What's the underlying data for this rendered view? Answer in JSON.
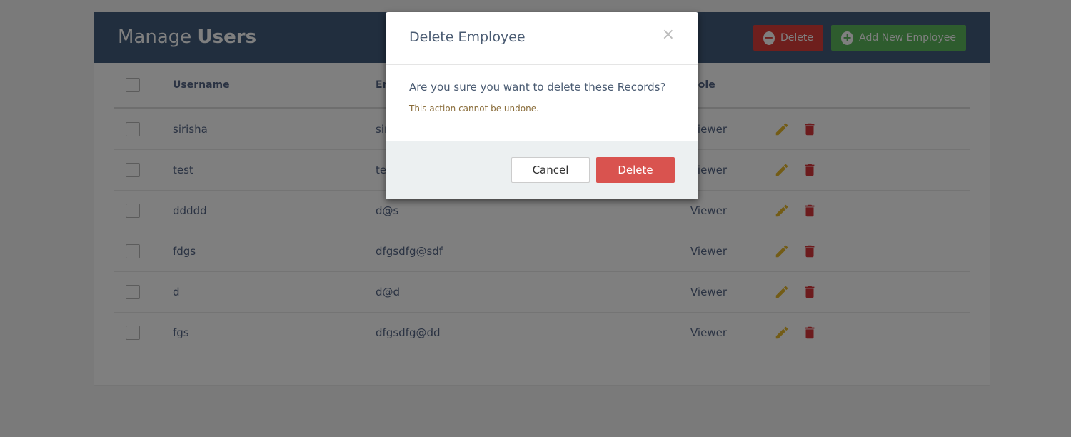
{
  "header": {
    "title_prefix": "Manage",
    "title_bold": "Users",
    "delete_label": "Delete",
    "add_label": "Add New Employee"
  },
  "table": {
    "columns": [
      "Username",
      "Email",
      "Role"
    ],
    "rows": [
      {
        "username": "sirisha",
        "email": "sirisha@gmail.com",
        "role": "Viewer"
      },
      {
        "username": "test",
        "email": "test@test",
        "role": "Viewer"
      },
      {
        "username": "ddddd",
        "email": "d@s",
        "role": "Viewer"
      },
      {
        "username": "fdgs",
        "email": "dfgsdfg@sdf",
        "role": "Viewer"
      },
      {
        "username": "d",
        "email": "d@d",
        "role": "Viewer"
      },
      {
        "username": "fgs",
        "email": "dfgsdfg@dd",
        "role": "Viewer"
      }
    ]
  },
  "modal": {
    "title": "Delete Employee",
    "close_glyph": "×",
    "question": "Are you sure you want to delete these Records?",
    "warning": "This action cannot be undone.",
    "cancel_label": "Cancel",
    "delete_label": "Delete"
  },
  "colors": {
    "header_bg": "#435d7d",
    "delete_red": "#dc3f3b",
    "add_green": "#5cb85c",
    "edit_yellow": "#e6b82d",
    "trash_red": "#d9373a"
  }
}
